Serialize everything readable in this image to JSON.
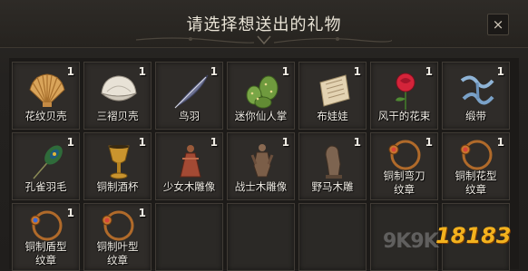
{
  "dialog": {
    "title": "请选择想送出的礼物",
    "close_label": "×"
  },
  "items": [
    {
      "name": "花纹贝壳",
      "count": "1",
      "icon": "scallop-shell-icon"
    },
    {
      "name": "三褶贝壳",
      "count": "1",
      "icon": "pearl-clam-icon"
    },
    {
      "name": "鸟羽",
      "count": "1",
      "icon": "quill-feather-icon"
    },
    {
      "name": "迷你仙人掌",
      "count": "1",
      "icon": "cactus-icon"
    },
    {
      "name": "布娃娃",
      "count": "1",
      "icon": "rag-doll-icon"
    },
    {
      "name": "风干的花束",
      "count": "1",
      "icon": "rose-icon"
    },
    {
      "name": "缎带",
      "count": "1",
      "icon": "ribbon-icon"
    },
    {
      "name": "孔雀羽毛",
      "count": "1",
      "icon": "peacock-feather-icon"
    },
    {
      "name": "铜制酒杯",
      "count": "1",
      "icon": "goblet-icon"
    },
    {
      "name": "少女木雕像",
      "count": "1",
      "icon": "maiden-statue-icon"
    },
    {
      "name": "战士木雕像",
      "count": "1",
      "icon": "warrior-statue-icon"
    },
    {
      "name": "野马木雕",
      "count": "1",
      "icon": "horse-statue-icon"
    },
    {
      "name": "铜制弯刀纹章",
      "count": "1",
      "icon": "emblem-amulet-icon"
    },
    {
      "name": "铜制花型纹章",
      "count": "1",
      "icon": "emblem-amulet-icon"
    },
    {
      "name": "铜制盾型纹章",
      "count": "1",
      "icon": "emblem-amulet-icon"
    },
    {
      "name": "铜制叶型纹章",
      "count": "1",
      "icon": "emblem-amulet-icon"
    }
  ],
  "watermark": {
    "site": "9K9K",
    "brand": "18183"
  },
  "colors": {
    "background": "#242220",
    "slot": "#2f2c29",
    "text": "#f4f0e8",
    "brand": "#f3b21e"
  }
}
